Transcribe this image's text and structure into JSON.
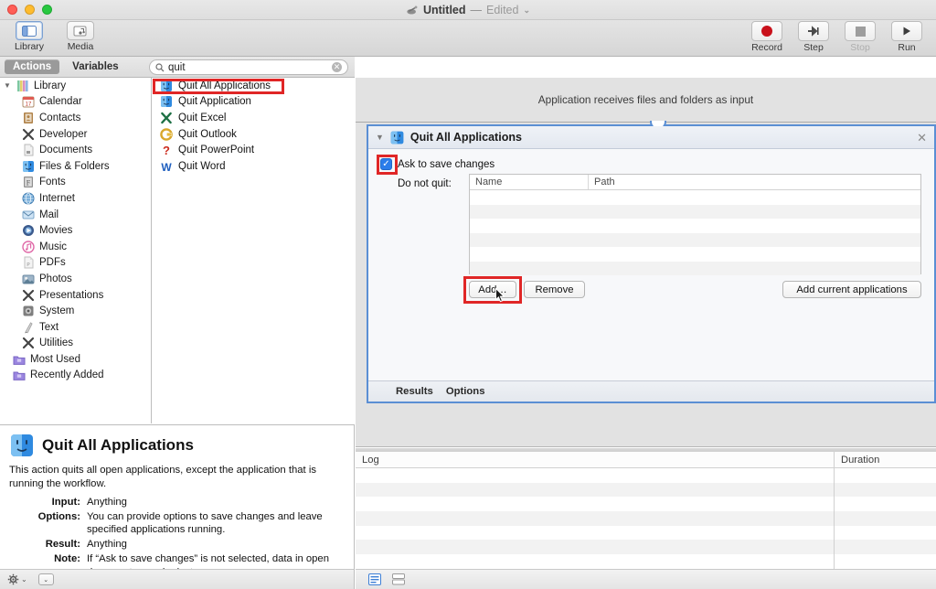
{
  "window": {
    "title": "Untitled",
    "dash": "—",
    "edited_label": "Edited",
    "chevron": "⌄",
    "doc_icon": "automator-robot-icon"
  },
  "toolbar": {
    "left_items": [
      {
        "label": "Library",
        "icon": "library-panel-icon",
        "active": true
      },
      {
        "label": "Media",
        "icon": "media-icon",
        "active": false
      }
    ],
    "right_items": [
      {
        "label": "Record",
        "icon": "record-dot-icon",
        "enabled": true
      },
      {
        "label": "Step",
        "icon": "step-arrow-icon",
        "enabled": true
      },
      {
        "label": "Stop",
        "icon": "stop-square-icon",
        "enabled": false
      },
      {
        "label": "Run",
        "icon": "run-triangle-icon",
        "enabled": true
      }
    ]
  },
  "tabs": {
    "actions_label": "Actions",
    "variables_label": "Variables",
    "selected": "Actions"
  },
  "search": {
    "value": "quit",
    "placeholder": "Search",
    "icon": "search-icon",
    "clear_icon": "clear-circle-icon",
    "clear_glyph": "✕"
  },
  "library": {
    "root_label": "Library",
    "root_icon": "library-stripes-icon",
    "disclosure": "▼",
    "items": [
      {
        "label": "Calendar",
        "icon": "calendar-icon"
      },
      {
        "label": "Contacts",
        "icon": "contacts-icon"
      },
      {
        "label": "Developer",
        "icon": "developer-icon"
      },
      {
        "label": "Documents",
        "icon": "documents-icon"
      },
      {
        "label": "Files & Folders",
        "icon": "finder-icon"
      },
      {
        "label": "Fonts",
        "icon": "fonts-icon"
      },
      {
        "label": "Internet",
        "icon": "internet-globe-icon"
      },
      {
        "label": "Mail",
        "icon": "mail-icon"
      },
      {
        "label": "Movies",
        "icon": "movies-icon"
      },
      {
        "label": "Music",
        "icon": "music-icon"
      },
      {
        "label": "PDFs",
        "icon": "pdf-icon"
      },
      {
        "label": "Photos",
        "icon": "photos-icon"
      },
      {
        "label": "Presentations",
        "icon": "presentations-icon"
      },
      {
        "label": "System",
        "icon": "system-icon"
      },
      {
        "label": "Text",
        "icon": "text-icon"
      },
      {
        "label": "Utilities",
        "icon": "utilities-icon"
      }
    ],
    "groups": [
      {
        "label": "Most Used",
        "icon": "smart-folder-icon"
      },
      {
        "label": "Recently Added",
        "icon": "smart-folder-icon"
      }
    ]
  },
  "actions_list": {
    "items": [
      {
        "label": "Quit All Applications",
        "icon": "finder-icon",
        "selected": true,
        "annotated": true
      },
      {
        "label": "Quit Application",
        "icon": "finder-icon",
        "selected": false,
        "annotated": false
      },
      {
        "label": "Quit Excel",
        "icon": "excel-icon",
        "selected": false,
        "annotated": false
      },
      {
        "label": "Quit Outlook",
        "icon": "outlook-icon",
        "selected": false,
        "annotated": false
      },
      {
        "label": "Quit PowerPoint",
        "icon": "powerpoint-icon",
        "selected": false,
        "annotated": false
      },
      {
        "label": "Quit Word",
        "icon": "word-icon",
        "selected": false,
        "annotated": false
      }
    ]
  },
  "description": {
    "title": "Quit All Applications",
    "icon": "finder-icon",
    "summary": "This action quits all open applications, except the application that is running the workflow.",
    "rows": [
      {
        "key": "Input:",
        "value": "Anything"
      },
      {
        "key": "Options:",
        "value": "You can provide options to save changes and leave specified applications running."
      },
      {
        "key": "Result:",
        "value": "Anything"
      },
      {
        "key": "Note:",
        "value": "If “Ask to save changes” is not selected, data in open documents may be lost."
      }
    ],
    "footer": {
      "gear_icon": "gear-icon",
      "gear_chevron": "⌄",
      "disclosure_icon": "disclosure-chevron-icon",
      "disclosure_glyph": "⌄"
    }
  },
  "workflow": {
    "banner": "Application receives files and folders as input",
    "action": {
      "title": "Quit All Applications",
      "icon": "finder-icon",
      "disclosure": "▼",
      "close_glyph": "✕",
      "checkbox": {
        "label": "Ask to save changes",
        "checked": true,
        "check_glyph": "✓",
        "annotated": true
      },
      "do_not_quit_label": "Do not quit:",
      "table": {
        "columns": [
          "Name",
          "Path"
        ],
        "rows": []
      },
      "buttons": [
        {
          "label": "Add…",
          "annotated": true
        },
        {
          "label": "Remove",
          "annotated": false
        },
        {
          "label": "Add current applications",
          "annotated": false
        }
      ],
      "footer_tabs": [
        "Results",
        "Options"
      ]
    }
  },
  "log": {
    "columns": [
      "Log",
      "Duration"
    ],
    "rows": [],
    "footer_icons": [
      {
        "name": "log-list-view-icon",
        "active": true
      },
      {
        "name": "log-split-view-icon",
        "active": false
      }
    ]
  },
  "colors": {
    "annotation_red": "#e02626",
    "selection_blue": "#5b8fd4",
    "checkbox_blue": "#2b7dea",
    "record_red": "#c9111b"
  }
}
